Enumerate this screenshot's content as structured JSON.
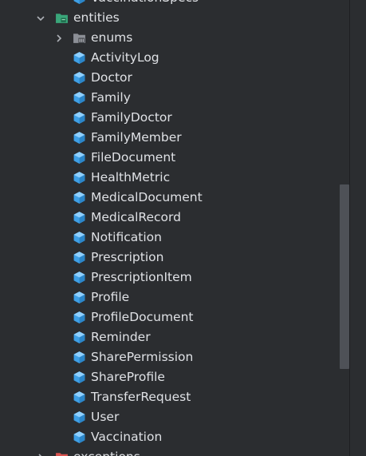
{
  "colors": {
    "background": "#2b2d30",
    "text": "#dfe1e5",
    "class_icon": "#3fa0e6",
    "package_icon_green": "#3aa67a",
    "package_icon_gray": "#8c8f96",
    "package_icon_red": "#d9534f",
    "scrollbar": "#4e5157"
  },
  "tree": {
    "above_item": {
      "label": "VaccinationSpecs",
      "icon": "class-icon"
    },
    "entities": {
      "label": "entities",
      "expanded": true,
      "icon": "package-icon"
    },
    "enums": {
      "label": "enums",
      "expanded": false,
      "icon": "package-icon"
    },
    "classes": [
      {
        "label": "ActivityLog",
        "icon": "class-icon"
      },
      {
        "label": "Doctor",
        "icon": "class-icon"
      },
      {
        "label": "Family",
        "icon": "class-icon"
      },
      {
        "label": "FamilyDoctor",
        "icon": "class-icon"
      },
      {
        "label": "FamilyMember",
        "icon": "class-icon"
      },
      {
        "label": "FileDocument",
        "icon": "class-icon"
      },
      {
        "label": "HealthMetric",
        "icon": "class-icon"
      },
      {
        "label": "MedicalDocument",
        "icon": "class-icon"
      },
      {
        "label": "MedicalRecord",
        "icon": "class-icon"
      },
      {
        "label": "Notification",
        "icon": "class-icon"
      },
      {
        "label": "Prescription",
        "icon": "class-icon"
      },
      {
        "label": "PrescriptionItem",
        "icon": "class-icon"
      },
      {
        "label": "Profile",
        "icon": "class-icon"
      },
      {
        "label": "ProfileDocument",
        "icon": "class-icon"
      },
      {
        "label": "Reminder",
        "icon": "class-icon"
      },
      {
        "label": "SharePermission",
        "icon": "class-icon"
      },
      {
        "label": "ShareProfile",
        "icon": "class-icon"
      },
      {
        "label": "TransferRequest",
        "icon": "class-icon"
      },
      {
        "label": "User",
        "icon": "class-icon"
      },
      {
        "label": "Vaccination",
        "icon": "class-icon"
      }
    ],
    "below_item": {
      "label": "exceptions",
      "expanded": false,
      "icon": "package-icon"
    }
  }
}
